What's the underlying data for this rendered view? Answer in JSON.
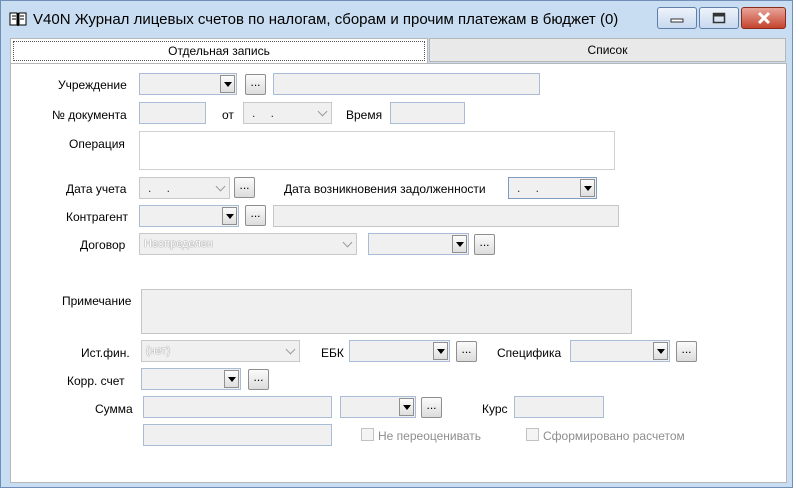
{
  "window": {
    "title": "V40N Журнал лицевых счетов по налогам, сборам и прочим платежам в бюджет (0)",
    "icon": "book-icon"
  },
  "tabs": [
    {
      "label": "Отдельная запись",
      "active": true
    },
    {
      "label": "Список",
      "active": false
    }
  ],
  "form": {
    "institution_label": "Учреждение",
    "doc_number_label": "№ документа",
    "from_label": "от",
    "date_placeholder": ". .",
    "time_label": "Время",
    "operation_label": "Операция",
    "accounting_date_label": "Дата учета",
    "debt_date_label": "Дата возникновения задолженности",
    "counterparty_label": "Контрагент",
    "contract_label": "Договор",
    "contract_value": "Неопределен",
    "note_label": "Примечание",
    "fin_source_label": "Ист.фин.",
    "fin_source_value": "(нет)",
    "ebk_label": "ЕБК",
    "specific_label": "Специфика",
    "corr_account_label": "Корр. счет",
    "sum_label": "Сумма",
    "rate_label": "Курс",
    "no_revalue_label": "Не переоценивать",
    "calculated_label": "Сформировано расчетом",
    "ellipsis": "..."
  },
  "colors": {
    "title_bar": "#c9ddf2",
    "close_button": "#c4452f",
    "field_border": "#a9bdd6",
    "field_fill": "#f0f0f0"
  }
}
